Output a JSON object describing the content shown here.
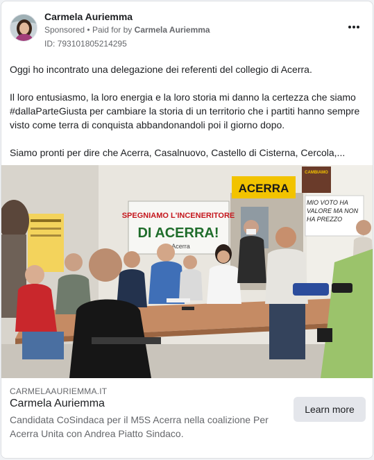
{
  "post": {
    "author": "Carmela Auriemma",
    "sponsored_label": "Sponsored",
    "separator": "•",
    "paid_for_prefix": "Paid for by",
    "paid_for_name": "Carmela Auriemma",
    "ad_id": "ID: 793101805214295",
    "menu_icon": "more-options-icon",
    "text": [
      "Oggi ho incontrato una delegazione dei referenti del collegio di Acerra.",
      "Il loro entusiasmo, la loro energia e la loro storia mi danno la certezza che siamo #dallaParteGiusta per cambiare la storia di un territorio che i partiti hanno sempre visto come terra di conquista abbandonandoli poi il giorno dopo.",
      "Siamo pronti per dire che Acerra, Casalnuovo, Castello di Cisterna, Cercola,..."
    ]
  },
  "photo": {
    "banner_line1": "SPEGNIAMO L'INCENERITORE",
    "banner_line2": "DI ACERRA!",
    "banner_line3": "p Acerra",
    "sign_acerra": "ACERRA",
    "poster_text": "MIO VOTO HA VALORE MA NON HA PREZZO",
    "wall_sign": "CAMBIAMO"
  },
  "link": {
    "domain": "CARMELAAURIEMMA.IT",
    "title": "Carmela Auriemma",
    "description": "Candidata CoSindaca per il M5S Acerra nella coalizione Per Acerra Unita con Andrea Piatto Sindaco.",
    "cta_label": "Learn more"
  }
}
